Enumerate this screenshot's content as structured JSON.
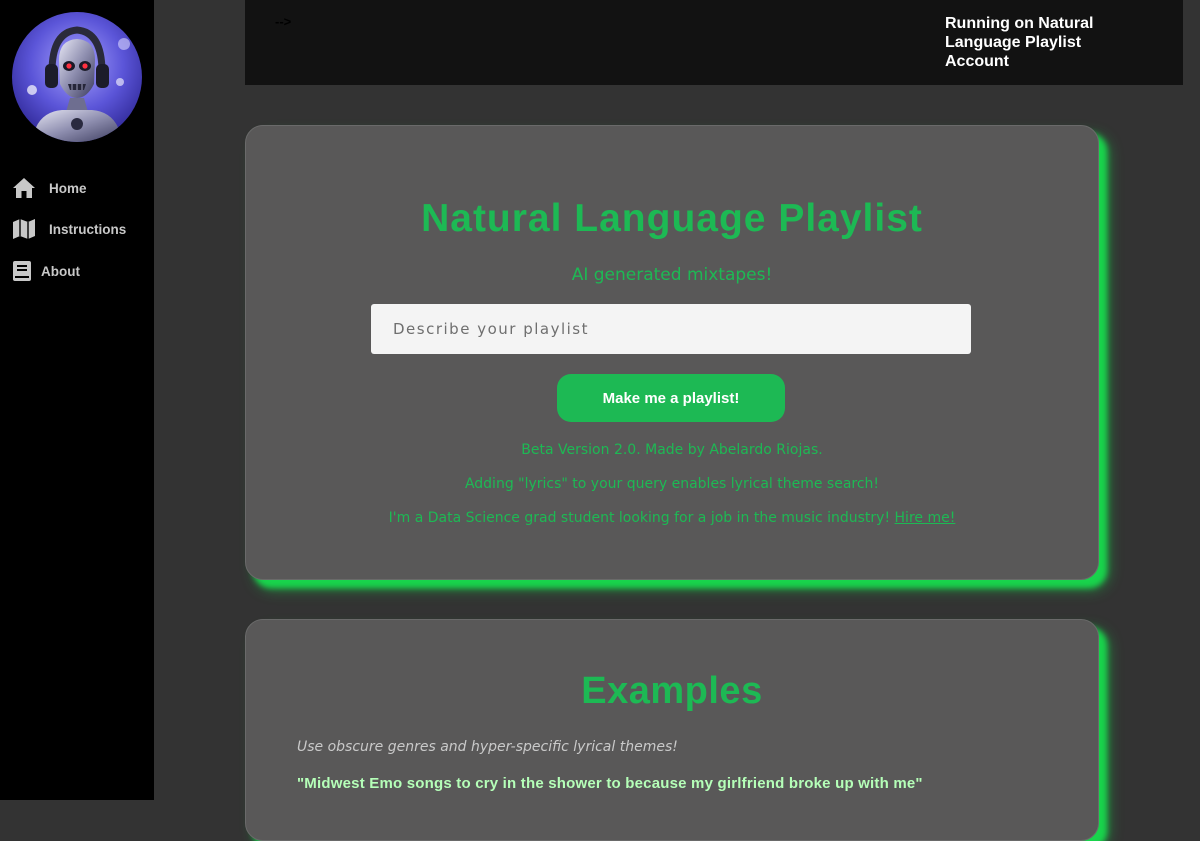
{
  "sidebar": {
    "items": [
      {
        "label": "Home",
        "icon": "home-icon"
      },
      {
        "label": "Instructions",
        "icon": "map-icon"
      },
      {
        "label": "About",
        "icon": "book-icon"
      }
    ]
  },
  "topbar": {
    "arrow": "-->",
    "status": "Running on Natural Language Playlist Account"
  },
  "hero": {
    "title": "Natural Language Playlist",
    "subtitle": "AI generated mixtapes!",
    "search_placeholder": "Describe your playlist",
    "button_label": "Make me a playlist!",
    "beta_text": "Beta Version 2.0. Made by Abelardo Riojas.",
    "lyrics_text": "Adding \"lyrics\" to your query enables lyrical theme search!",
    "hire_text": "I'm a Data Science grad student looking for a job in the music industry!",
    "hire_link": "Hire me!"
  },
  "examples": {
    "title": "Examples",
    "hint": "Use obscure genres and hyper-specific lyrical themes!",
    "first_example": "\"Midwest Emo songs to cry in the shower to because my girlfriend broke up with me\""
  },
  "colors": {
    "accent": "#1db954",
    "sidebar_bg": "#000000",
    "page_bg": "#333333",
    "card_bg": "#595858",
    "topbar_bg": "#121212"
  }
}
